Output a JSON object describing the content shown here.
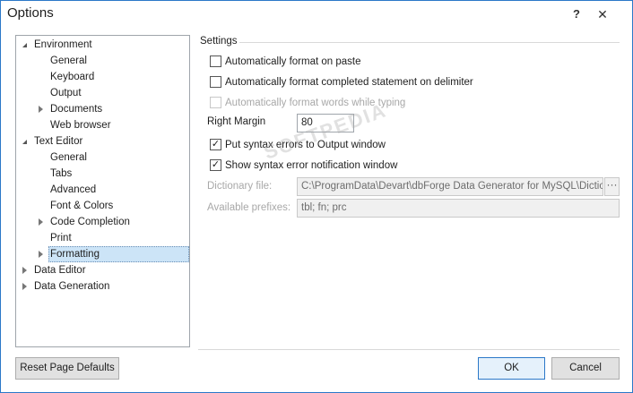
{
  "window": {
    "title": "Options",
    "help_glyph": "?",
    "close_glyph": "✕",
    "accent_color": "#2b78c8"
  },
  "tree": {
    "items": [
      {
        "label": "Environment",
        "state": "expanded",
        "level": 0
      },
      {
        "label": "General",
        "state": "leaf",
        "level": 1
      },
      {
        "label": "Keyboard",
        "state": "leaf",
        "level": 1
      },
      {
        "label": "Output",
        "state": "leaf",
        "level": 1
      },
      {
        "label": "Documents",
        "state": "collapsed",
        "level": 1
      },
      {
        "label": "Web browser",
        "state": "leaf",
        "level": 1
      },
      {
        "label": "Text Editor",
        "state": "expanded",
        "level": 0
      },
      {
        "label": "General",
        "state": "leaf",
        "level": 1
      },
      {
        "label": "Tabs",
        "state": "leaf",
        "level": 1
      },
      {
        "label": "Advanced",
        "state": "leaf",
        "level": 1
      },
      {
        "label": "Font & Colors",
        "state": "leaf",
        "level": 1
      },
      {
        "label": "Code Completion",
        "state": "collapsed",
        "level": 1
      },
      {
        "label": "Print",
        "state": "leaf",
        "level": 1
      },
      {
        "label": "Formatting",
        "state": "collapsed",
        "level": 1,
        "selected": true
      },
      {
        "label": "Data Editor",
        "state": "collapsed",
        "level": 0
      },
      {
        "label": "Data Generation",
        "state": "collapsed",
        "level": 0
      }
    ]
  },
  "settings": {
    "section_title": "Settings",
    "auto_format_paste": {
      "label": "Automatically format on paste",
      "checked": false,
      "enabled": true
    },
    "auto_format_delimiter": {
      "label": "Automatically format completed statement on delimiter",
      "checked": false,
      "enabled": true
    },
    "auto_format_typing": {
      "label": "Automatically format words while typing",
      "checked": false,
      "enabled": false
    },
    "right_margin": {
      "label": "Right Margin",
      "value": "80"
    },
    "syntax_errors_output": {
      "label": "Put syntax errors to Output window",
      "checked": true,
      "enabled": true,
      "check_glyph": "✓"
    },
    "syntax_error_notification": {
      "label": "Show syntax error notification window",
      "checked": true,
      "enabled": true,
      "check_glyph": "✓"
    },
    "dictionary_file": {
      "label": "Dictionary file:",
      "value": "C:\\ProgramData\\Devart\\dbForge Data Generator for MySQL\\Dictio...",
      "browse_glyph": "···"
    },
    "available_prefixes": {
      "label": "Available prefixes:",
      "value": "tbl; fn; prc"
    }
  },
  "buttons": {
    "reset": "Reset Page Defaults",
    "ok": "OK",
    "cancel": "Cancel"
  },
  "watermark": "SOFTPEDIA"
}
